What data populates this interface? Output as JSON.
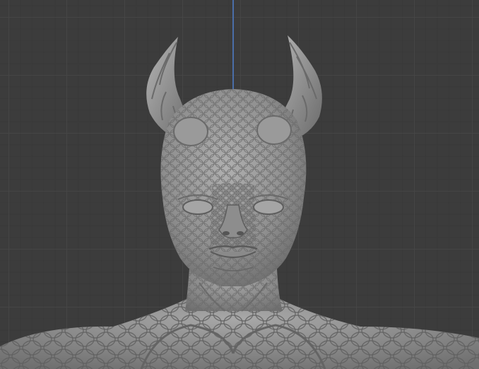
{
  "viewport": {
    "background_color": "#3c3c3c",
    "grid_color": "#474747",
    "z_axis_color": "#4a6ea8",
    "model_color": "#8e8e8e",
    "model_shadow": "#5e5e5e",
    "model_highlight": "#b4b4b4"
  }
}
